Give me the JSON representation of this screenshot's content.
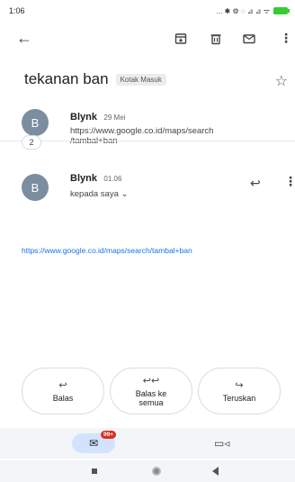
{
  "status_bar": {
    "time": "1:06",
    "icons": "... ✱ ⚙ ◌ ⊿ ⊿ ᯤ"
  },
  "toolbar": {
    "back_glyph": "←",
    "archive_glyph": "⊡",
    "delete_glyph": "🗑",
    "mail_glyph": "✉",
    "more_glyph": "⋮"
  },
  "email": {
    "subject": "tekanan ban",
    "label_chip": "Kotak Masuk",
    "star_glyph": "☆",
    "collapsed_count": "2",
    "messages": [
      {
        "avatar_letter": "B",
        "sender": "Blynk",
        "date": "29 Mei",
        "snippet": "https://www.google.co.id/maps/search\n/tambal+ban"
      },
      {
        "avatar_letter": "B",
        "sender": "Blynk",
        "date": "01.06",
        "recipient": "kepada saya ⌄",
        "reply_glyph": "↩",
        "more_glyph": "⋮"
      }
    ],
    "body_link": "https://www.google.co.id/maps/search/tambal+ban"
  },
  "actions": [
    {
      "icon": "↩",
      "label": "Balas"
    },
    {
      "icon": "↩↩",
      "label": "Balas ke\nsemua"
    },
    {
      "icon": "↪",
      "label": "Teruskan"
    }
  ],
  "bottom_nav": {
    "mail_glyph": "✉",
    "badge": "99+",
    "meet_glyph": "▭◃"
  },
  "colors": {
    "link": "#1a73e8",
    "badge": "#d93025",
    "avatar": "#7a8ea0",
    "mail_pill": "#d3e3fd"
  }
}
